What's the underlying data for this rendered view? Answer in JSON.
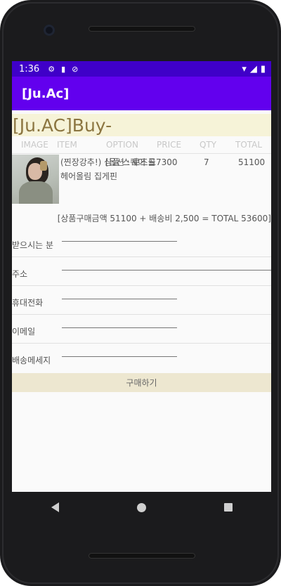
{
  "status_bar": {
    "time": "1:36",
    "icons": [
      "settings-gear-icon",
      "sd-card-icon",
      "data-saver-icon"
    ],
    "right_icons": [
      "wifi-icon",
      "signal-icon",
      "battery-icon"
    ]
  },
  "app_bar": {
    "title": "[Ju.Ac]"
  },
  "page": {
    "heading": "[Ju.AC]Buy-"
  },
  "table": {
    "headers": [
      "IMAGE",
      "ITEM",
      "OPTION",
      "PRICE",
      "QTY",
      "TOTAL"
    ],
    "rows": [
      {
        "item": "(찐장강추!) 심플 스퀘어 드 헤어올림 집게핀",
        "option": "[옵션 : 로즈골",
        "price": "7300",
        "qty": "7",
        "total": "51100"
      }
    ]
  },
  "summary": "[상품구매금액 51100 + 배송비 2,500 = TOTAL 53600]",
  "form": {
    "recipient_label": "받으시는 분",
    "address_label": "주소",
    "phone_label": "휴대전화",
    "email_label": "이메일",
    "message_label": "배송메세지"
  },
  "buy_button": "구매하기",
  "colors": {
    "status_bar": "#3f00c8",
    "app_bar": "#6200ee",
    "heading_bg": "#f6f3d8",
    "heading_text": "#8b7540",
    "button_bg": "#ede7d0"
  }
}
